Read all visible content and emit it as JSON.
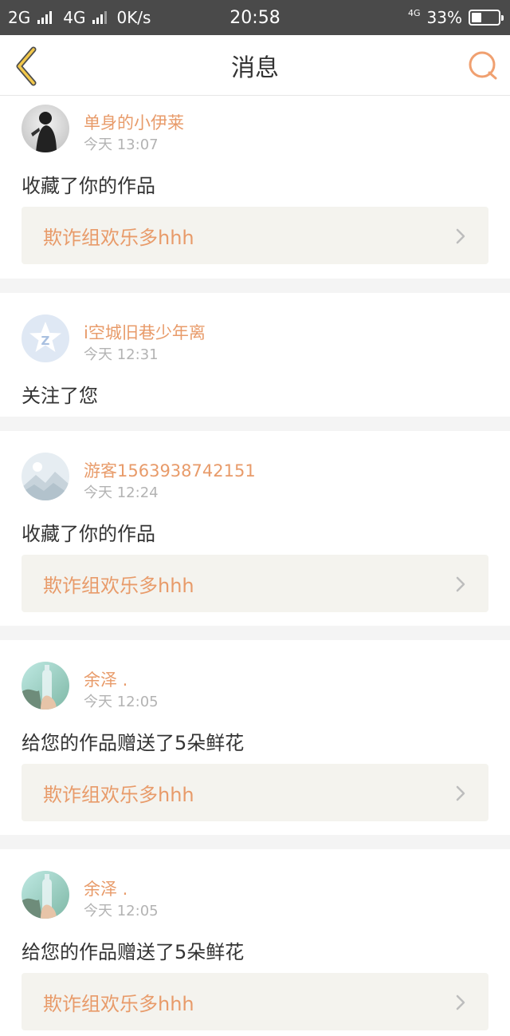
{
  "status_bar": {
    "net1": "2G",
    "net2": "4G",
    "speed": "0K/s",
    "time": "20:58",
    "net_small": "4G",
    "battery": "33%",
    "battery_level": 0.33
  },
  "nav": {
    "title": "消息",
    "back_icon": "chevron-left-icon",
    "search_icon": "search-icon",
    "accent": "#f0a070"
  },
  "colors": {
    "username": "#e89b6a",
    "timestamp": "#b3b3b3",
    "work_bg": "#f4f3ee",
    "separator": "#f4f4f4"
  },
  "messages": [
    {
      "user": "单身的小伊莱",
      "time": "今天 13:07",
      "action": "收藏了你的作品",
      "work": "欺诈组欢乐多hhh",
      "avatar": "avatar-dark-figure"
    },
    {
      "user": "i空城旧巷少年离",
      "time": "今天 12:31",
      "action": "关注了您",
      "work": null,
      "avatar": "avatar-qzone-star"
    },
    {
      "user": "游客1563938742151",
      "time": "今天 12:24",
      "action": "收藏了你的作品",
      "work": "欺诈组欢乐多hhh",
      "avatar": "avatar-mountain-placeholder"
    },
    {
      "user": "余泽 .",
      "time": "今天 12:05",
      "action": "给您的作品赠送了5朵鲜花",
      "work": "欺诈组欢乐多hhh",
      "avatar": "avatar-bottle-photo"
    },
    {
      "user": "余泽 .",
      "time": "今天 12:05",
      "action": "给您的作品赠送了5朵鲜花",
      "work": "欺诈组欢乐多hhh",
      "avatar": "avatar-bottle-photo"
    }
  ]
}
